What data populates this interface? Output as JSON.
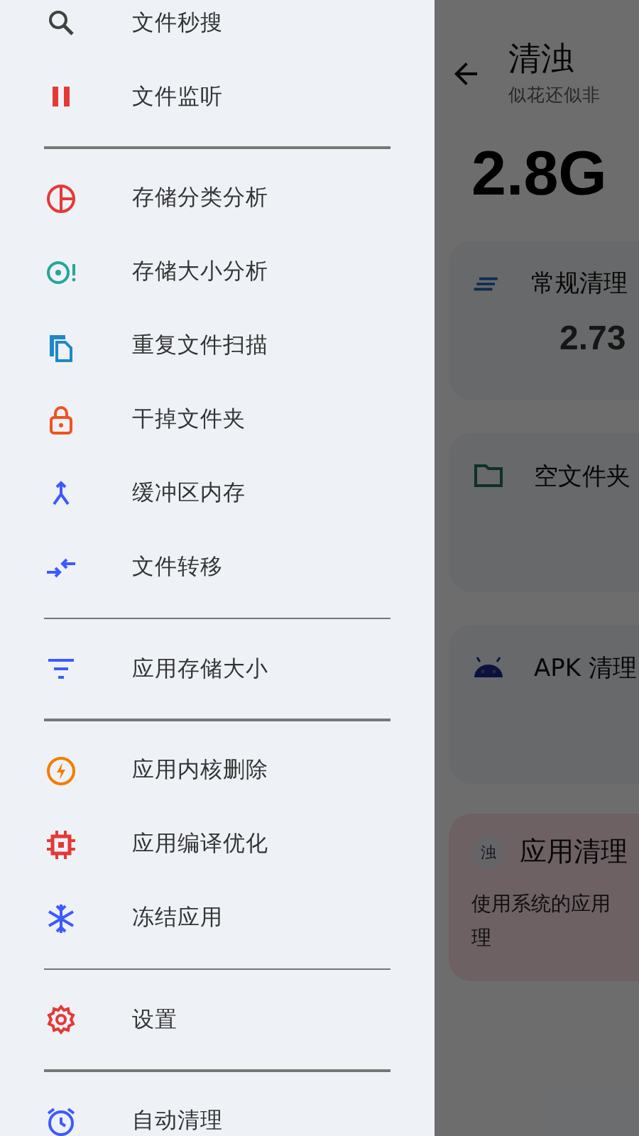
{
  "drawer": {
    "groups": [
      {
        "items": [
          {
            "label": "文件秒搜",
            "kind": "search",
            "color": "#424242"
          },
          {
            "label": "文件监听",
            "kind": "pause",
            "color": "#e53935"
          }
        ]
      },
      {
        "items": [
          {
            "label": "存储分类分析",
            "kind": "pie",
            "color": "#e53935"
          },
          {
            "label": "存储大小分析",
            "kind": "target",
            "color": "#26a69a"
          },
          {
            "label": "重复文件扫描",
            "kind": "copy",
            "color": "#1e88c8"
          },
          {
            "label": "干掉文件夹",
            "kind": "lock",
            "color": "#f4511e"
          },
          {
            "label": "缓冲区内存",
            "kind": "merge",
            "color": "#3d5afe"
          },
          {
            "label": "文件转移",
            "kind": "swap",
            "color": "#3d5afe"
          }
        ]
      },
      {
        "items": [
          {
            "label": "应用存储大小",
            "kind": "filter",
            "color": "#3d5afe"
          }
        ]
      },
      {
        "items": [
          {
            "label": "应用内核删除",
            "kind": "bolt",
            "color": "#f57c00"
          },
          {
            "label": "应用编译优化",
            "kind": "chip",
            "color": "#e53935"
          },
          {
            "label": "冻结应用",
            "kind": "snowflake",
            "color": "#3d5afe"
          }
        ]
      },
      {
        "items": [
          {
            "label": "设置",
            "kind": "gear",
            "color": "#e53935"
          }
        ]
      },
      {
        "items": [
          {
            "label": "自动清理",
            "kind": "alarm",
            "color": "#3d5afe"
          }
        ]
      }
    ]
  },
  "page": {
    "title": "清浊",
    "subtitle": "似花还似非",
    "total": "2.8G",
    "cards": [
      {
        "kind": "lines",
        "title": "常规清理",
        "value": "2.73"
      },
      {
        "kind": "folder",
        "title": "空文件夹"
      },
      {
        "kind": "android",
        "title": "APK 清理"
      }
    ],
    "app_card": {
      "badge": "浊",
      "title": "应用清理",
      "text": "使用系统的应用理"
    }
  }
}
